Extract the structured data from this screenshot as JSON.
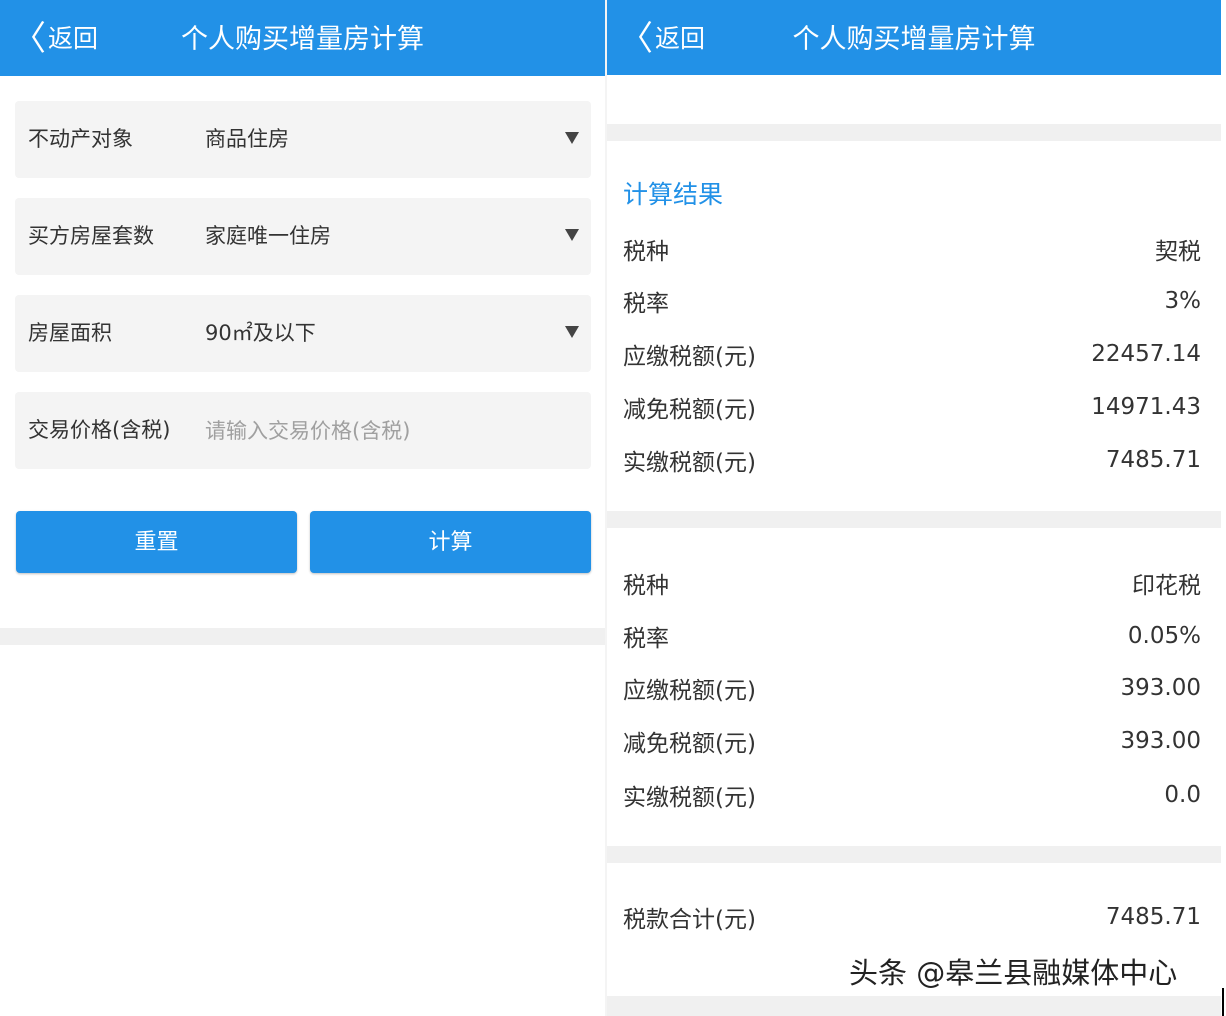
{
  "colors": {
    "primary": "#2291e7",
    "field_bg": "#f4f4f4",
    "band": "#f0f0f0"
  },
  "left": {
    "header": {
      "back_chevron": "〈",
      "back_label": "返回",
      "title": "个人购买增量房计算"
    },
    "fields": [
      {
        "label": "不动产对象",
        "value": "商品住房",
        "icon": "caret-down-icon"
      },
      {
        "label": "买方房屋套数",
        "value": "家庭唯一住房",
        "icon": "caret-down-icon"
      },
      {
        "label": "房屋面积",
        "value": "90㎡及以下",
        "icon": "caret-down-icon"
      },
      {
        "label": "交易价格(含税)",
        "placeholder": "请输入交易价格(含税)"
      }
    ],
    "buttons": {
      "reset": "重置",
      "calculate": "计算"
    }
  },
  "right": {
    "header": {
      "back_chevron": "〈",
      "back_label": "返回",
      "title": "个人购买增量房计算"
    },
    "result_title": "计算结果",
    "deed_tax": [
      {
        "label": "税种",
        "value": "契税"
      },
      {
        "label": "税率",
        "value": "3%"
      },
      {
        "label": "应缴税额(元)",
        "value": "22457.14"
      },
      {
        "label": "减免税额(元)",
        "value": "14971.43"
      },
      {
        "label": "实缴税额(元)",
        "value": "7485.71"
      }
    ],
    "stamp_tax": [
      {
        "label": "税种",
        "value": "印花税"
      },
      {
        "label": "税率",
        "value": "0.05%"
      },
      {
        "label": "应缴税额(元)",
        "value": "393.00"
      },
      {
        "label": "减免税额(元)",
        "value": "393.00"
      },
      {
        "label": "实缴税额(元)",
        "value": "0.0"
      }
    ],
    "total": {
      "label": "税款合计(元)",
      "value": "7485.71"
    }
  },
  "watermark": "头条 @皋兰县融媒体中心"
}
